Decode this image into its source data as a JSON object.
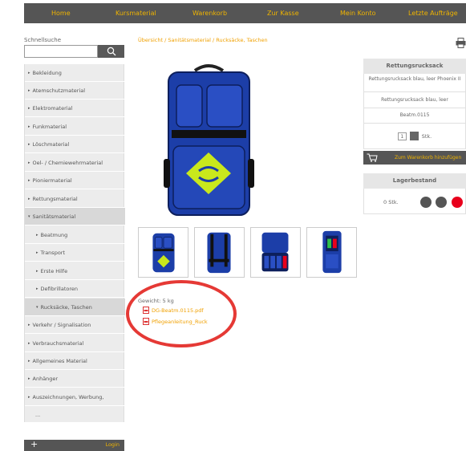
{
  "nav": {
    "items": [
      "Home",
      "Kursmaterial",
      "Warenkorb",
      "Zur Kasse",
      "Mein Konto",
      "Letzte Aufträge"
    ]
  },
  "search": {
    "label": "Schnellsuche",
    "placeholder": ""
  },
  "sidebar": {
    "items": [
      {
        "label": "Bekleidung",
        "arrow": "▸"
      },
      {
        "label": "Atemschutzmaterial",
        "arrow": "▸"
      },
      {
        "label": "Elektromaterial",
        "arrow": "▸"
      },
      {
        "label": "Funkmaterial",
        "arrow": "▸"
      },
      {
        "label": "Löschmaterial",
        "arrow": "▸"
      },
      {
        "label": "Oel- / Chemiewehrmaterial",
        "arrow": "▸"
      },
      {
        "label": "Pioniermaterial",
        "arrow": "▸"
      },
      {
        "label": "Rettungsmaterial",
        "arrow": "▸"
      },
      {
        "label": "Sanitätsmaterial",
        "arrow": "▾"
      },
      {
        "label": "Beatmung",
        "arrow": "▸"
      },
      {
        "label": "Transport",
        "arrow": "▸"
      },
      {
        "label": "Erste Hilfe",
        "arrow": "▸"
      },
      {
        "label": "Defibrillatoren",
        "arrow": "▸"
      },
      {
        "label": "Rucksäcke, Taschen",
        "arrow": "▾"
      },
      {
        "label": "Verkehr / Signalisation",
        "arrow": "▸"
      },
      {
        "label": "Verbrauchsmaterial",
        "arrow": "▸"
      },
      {
        "label": "Allgemeines Material",
        "arrow": "▸"
      },
      {
        "label": "Anhänger",
        "arrow": "▸"
      },
      {
        "label": "Auszeichnungen, Werbung,",
        "arrow": "▸"
      },
      {
        "label": "...",
        "arrow": ""
      }
    ]
  },
  "bottombar": {
    "plus": "+",
    "login": "Login"
  },
  "breadcrumb": {
    "parts": [
      "Übersicht",
      "Sanitätsmaterial",
      "Rucksäcke, Taschen"
    ],
    "sep": " / "
  },
  "product": {
    "weight": "Gewicht: 5 kg",
    "files": [
      "DG-Beatm.0115.pdf",
      "Pflegeanleitung_Ruck"
    ]
  },
  "info": {
    "title": "Rettungsrucksack",
    "desc": "Rettungsrucksack blau, leer Phoenix II",
    "desc2": "Rettungsrucksack blau, leer",
    "article": "Beatm.0115",
    "qty": "1",
    "unit": "Stk."
  },
  "cart": {
    "label": "Zum Warenkorb hinzufügen"
  },
  "stock": {
    "title": "Lagerbestand",
    "value": "0 Stk.",
    "colors": [
      "#555555",
      "#555555",
      "#e8001c"
    ]
  },
  "colors": {
    "accent": "#f0b400",
    "bar": "#555555",
    "highlight": "#e53935"
  }
}
